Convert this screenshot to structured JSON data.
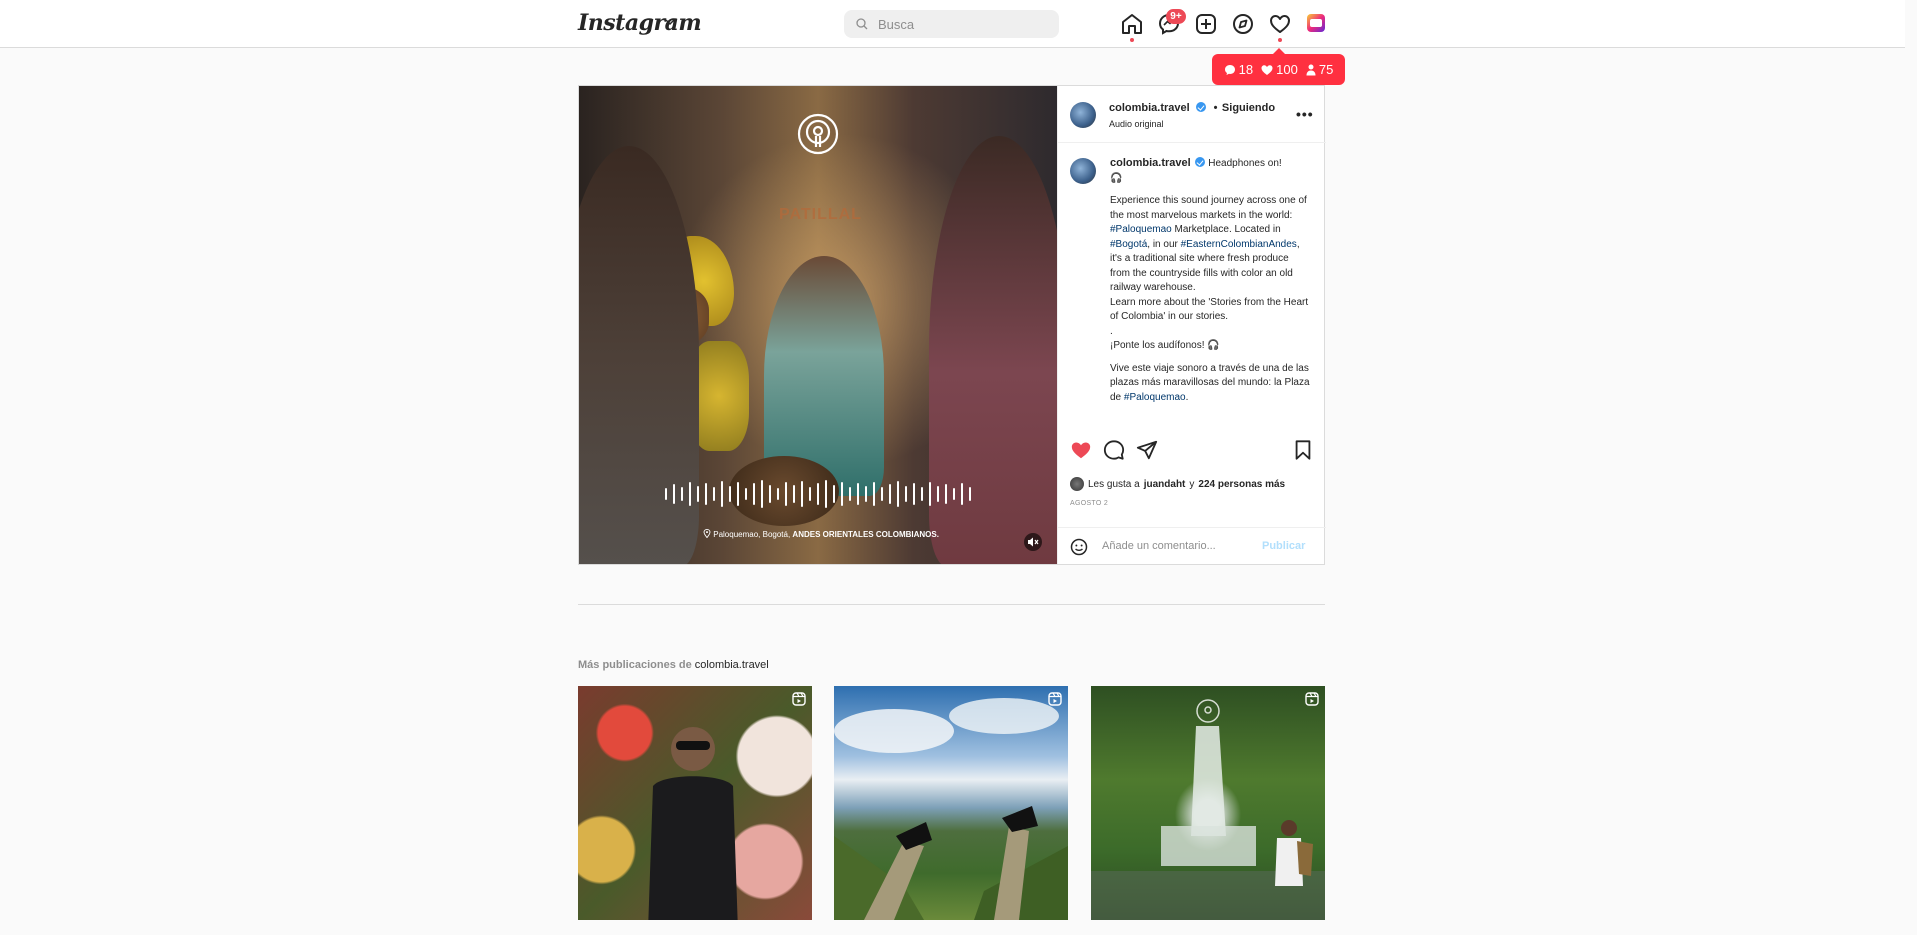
{
  "header": {
    "logo_text": "Instagram",
    "search_placeholder": "Busca",
    "messages_badge": "9+",
    "nav_icons": [
      "home-icon",
      "messenger-icon",
      "new-post-icon",
      "explore-icon",
      "activity-heart-icon",
      "profile-avatar"
    ]
  },
  "notification_popup": {
    "comments": "18",
    "likes": "100",
    "followers": "75",
    "color": "#ff3040"
  },
  "post": {
    "author": "colombia.travel",
    "separator": "•",
    "follow_status": "Siguiendo",
    "audio": "Audio original",
    "media": {
      "market_sign": "PATILLAL",
      "location_text": "Paloquemao, Bogotá,",
      "location_bold": "ANDES ORIENTALES COLOMBIANOS."
    },
    "caption": {
      "author": "colombia.travel",
      "line1": "Headphones on!",
      "line2": "Experience this sound journey across one of the most marvelous markets in the world:",
      "tag1": "#Paloquemao",
      "line3": "Marketplace. Located in",
      "tag2": "#Bogotá",
      "line4": ", in our",
      "tag3": "#EasternColombianAndes",
      "line5": ", it's a traditional site where fresh produce from the countryside fills with color an old railway warehouse.",
      "line6": "Learn more about the 'Stories from the Heart of Colombia' in our stories.",
      "line7": ".",
      "line8": "¡Ponte los audífonos!",
      "line9": "Vive este viaje sonoro a través de una de las plazas más maravillosas del mundo: la Plaza de",
      "tag4": "#Paloquemao",
      "line10": "."
    },
    "likes": {
      "prefix": "Les gusta a",
      "user": "juandaht",
      "connector": "y",
      "others": "224 personas más"
    },
    "date": "AGOSTO 2",
    "comment_placeholder": "Añade un comentario...",
    "publish_label": "Publicar",
    "like_color": "#ed4956"
  },
  "more_posts": {
    "prefix": "Más publicaciones de",
    "author": "colombia.travel",
    "thumbnails": [
      "reel-thumbnail-1",
      "reel-thumbnail-2",
      "reel-thumbnail-3"
    ]
  }
}
